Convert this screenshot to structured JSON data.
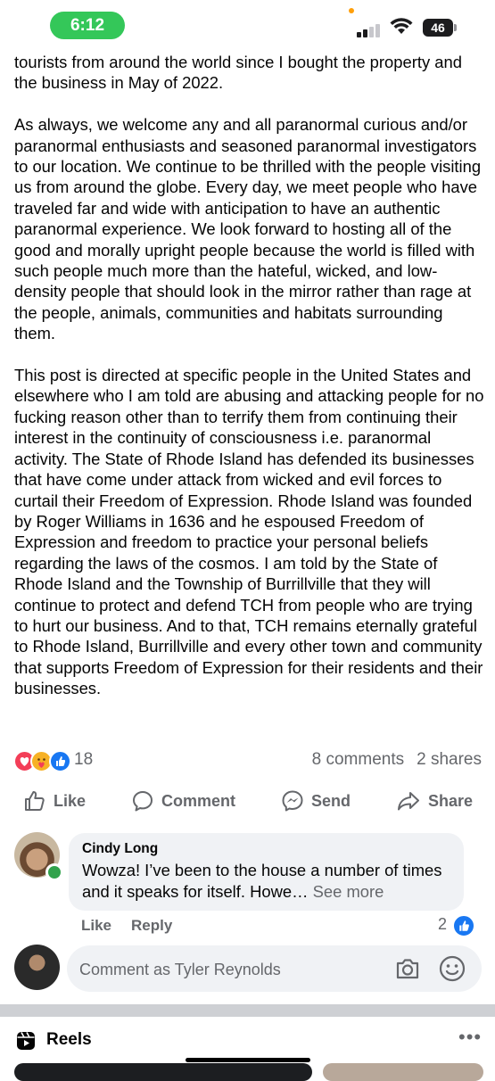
{
  "status_bar": {
    "time": "6:12",
    "battery": "46"
  },
  "post": {
    "paragraphs": [
      "tourists from around the world since I bought the property and the business in May of 2022.",
      "As always, we welcome any and all paranormal curious and/or paranormal enthusiasts and seasoned paranormal investigators to our location. We continue to be thrilled with the people visiting us from around the globe. Every day, we meet people who have traveled far and wide with anticipation to have an authentic paranormal experience. We look forward to hosting all of the good and morally upright people because the world is filled with such people much more than the hateful, wicked, and low-density people that should look in the mirror rather than rage at the people, animals, communities and habitats surrounding them.",
      "This post is directed at specific people in the United States and elsewhere who I am told are abusing and attacking people for no fucking reason other than to terrify them from continuing their interest in the continuity of consciousness i.e. paranormal activity. The State of Rhode Island has defended its businesses that have come under attack from wicked and evil forces to curtail their Freedom of Expression. Rhode Island was founded by Roger Williams in 1636 and he espoused Freedom of Expression and freedom to practice your personal beliefs regarding the laws of the cosmos. I am told by the State of Rhode Island and the Township of Burrillville that they will continue to protect and defend TCH from people who are trying to hurt our business. And to that, TCH remains eternally grateful to Rhode Island, Burrillville and every other town and community that supports Freedom of Expression for their residents and their businesses."
    ],
    "reaction_count": "18",
    "comments_count": "8 comments",
    "shares_count": "2 shares",
    "reaction_icons": [
      "heart-icon",
      "care-icon",
      "like-icon"
    ],
    "colors": {
      "like_blue": "#1877f2",
      "love_red": "#f33e58",
      "care_yellow": "#f7b125"
    }
  },
  "actions": {
    "like": "Like",
    "comment": "Comment",
    "send": "Send",
    "share": "Share"
  },
  "comment": {
    "author": "Cindy Long",
    "text": "Wowza! I’ve been to the house a number of times and it speaks for itself. Howe…",
    "see_more": "See more",
    "like_label": "Like",
    "reply_label": "Reply",
    "like_count": "2"
  },
  "composer": {
    "placeholder": "Comment as Tyler Reynolds"
  },
  "reels": {
    "label": "Reels",
    "more": "•••"
  }
}
